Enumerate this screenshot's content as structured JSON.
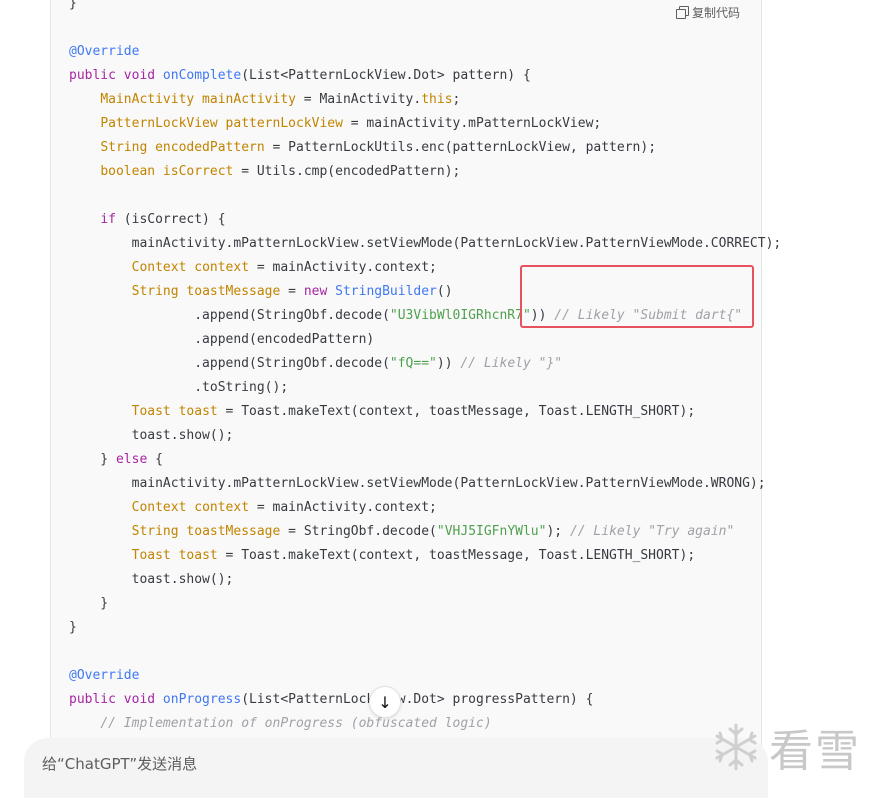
{
  "toolbar": {
    "copy_label": "复制代码"
  },
  "code": {
    "l0": "}",
    "l2": "@Override",
    "l3": [
      "public void ",
      "onComplete",
      "(List<PatternLockView.Dot> pattern) {"
    ],
    "l4": [
      "    ",
      "MainActivity mainActivity",
      " = MainActivity.",
      "this",
      ";"
    ],
    "l5": [
      "    ",
      "PatternLockView patternLockView",
      " = mainActivity.mPatternLockView;"
    ],
    "l6": [
      "    ",
      "String encodedPattern",
      " = PatternLockUtils.enc(patternLockView, pattern);"
    ],
    "l7": [
      "    ",
      "boolean isCorrect",
      " = Utils.cmp(encodedPattern);"
    ],
    "l9": [
      "    ",
      "if",
      " (isCorrect) {"
    ],
    "l10": "        mainActivity.mPatternLockView.setViewMode(PatternLockView.PatternViewMode.CORRECT);",
    "l11": [
      "        ",
      "Context context",
      " = mainActivity.context;"
    ],
    "l12": [
      "        ",
      "String toastMessage",
      " = ",
      "new",
      " ",
      "StringBuilder",
      "()"
    ],
    "l13": [
      "                .append(StringObf.decode(",
      "\"U3VibWl0IGRhcnR7\"",
      ")) ",
      "// Likely \"Submit dart{\""
    ],
    "l14": "                .append(encodedPattern)",
    "l15": [
      "                .append(StringObf.decode(",
      "\"fQ==\"",
      ")) ",
      "// Likely \"}\""
    ],
    "l16": "                .toString();",
    "l17": [
      "        ",
      "Toast toast",
      " = Toast.makeText(context, toastMessage, Toast.LENGTH_SHORT);"
    ],
    "l18": "        toast.show();",
    "l19": [
      "    } ",
      "else",
      " {"
    ],
    "l20": "        mainActivity.mPatternLockView.setViewMode(PatternLockView.PatternViewMode.WRONG);",
    "l21": [
      "        ",
      "Context context",
      " = mainActivity.context;"
    ],
    "l22": [
      "        ",
      "String toastMessage",
      " = StringObf.decode(",
      "\"VHJ5IGFnYWlu\"",
      "); ",
      "// Likely \"Try again\""
    ],
    "l23": [
      "        ",
      "Toast toast",
      " = Toast.makeText(context, toastMessage, Toast.LENGTH_SHORT);"
    ],
    "l24": "        toast.show();",
    "l25": "    }",
    "l26": "}",
    "l28": "@Override",
    "l29": [
      "public void ",
      "onProgress",
      "(List<PatternLockView.Dot> progressPattern) {"
    ],
    "l30": [
      "    ",
      "// Implementation of onProgress (obfuscated logic)"
    ]
  },
  "composer": {
    "placeholder": "给“ChatGPT”发送消息"
  },
  "watermark": {
    "text": "看雪"
  },
  "icons": {
    "copy": "copy-icon",
    "scroll": "arrow-down-icon",
    "watermark": "snowflake-icon"
  },
  "colors": {
    "highlight": "#e8525f",
    "keyword": "#a626a4",
    "type": "#c18401",
    "function": "#4078f2",
    "string": "#50a14f",
    "comment": "#a0a1a7"
  }
}
